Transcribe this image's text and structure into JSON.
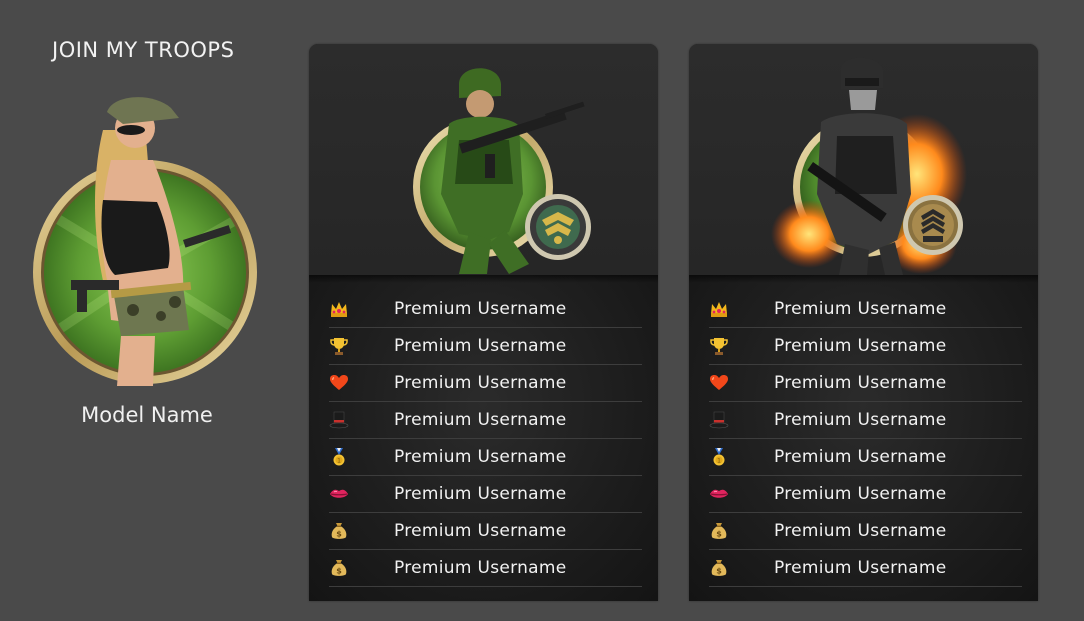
{
  "heading": "JOIN MY TROOPS",
  "model": {
    "name": "Model Name"
  },
  "colors": {
    "page_background": "#4a4a4a",
    "card_background": "#202020",
    "text": "#f2f2f2",
    "badge_green": "#5c9a35",
    "frame_gold": "#c8b27a"
  },
  "cards": [
    {
      "avatar_icon": "soldier-rifle-avatar",
      "rank_badge_icon": "eagle-chevron-badge-icon",
      "rows": [
        {
          "icon": "crown-icon",
          "label": "Premium Username"
        },
        {
          "icon": "trophy-icon",
          "label": "Premium Username"
        },
        {
          "icon": "heart-icon",
          "label": "Premium Username"
        },
        {
          "icon": "top-hat-icon",
          "label": "Premium Username"
        },
        {
          "icon": "medal-icon",
          "label": "Premium Username"
        },
        {
          "icon": "lips-icon",
          "label": "Premium Username"
        },
        {
          "icon": "money-bag-icon",
          "label": "Premium Username"
        },
        {
          "icon": "money-bag-icon",
          "label": "Premium Username"
        }
      ]
    },
    {
      "avatar_icon": "soldier-fire-avatar",
      "rank_badge_icon": "sergeant-chevron-badge-icon",
      "rows": [
        {
          "icon": "crown-icon",
          "label": "Premium Username"
        },
        {
          "icon": "trophy-icon",
          "label": "Premium Username"
        },
        {
          "icon": "heart-icon",
          "label": "Premium Username"
        },
        {
          "icon": "top-hat-icon",
          "label": "Premium Username"
        },
        {
          "icon": "medal-icon",
          "label": "Premium Username"
        },
        {
          "icon": "lips-icon",
          "label": "Premium Username"
        },
        {
          "icon": "money-bag-icon",
          "label": "Premium Username"
        },
        {
          "icon": "money-bag-icon",
          "label": "Premium Username"
        }
      ]
    }
  ]
}
